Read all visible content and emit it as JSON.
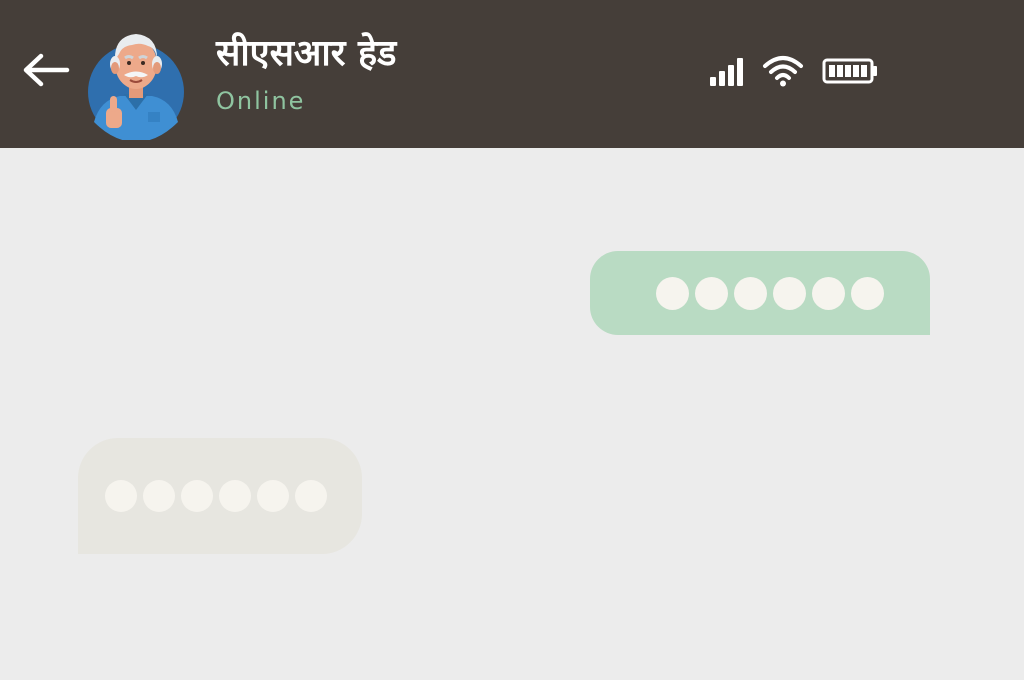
{
  "header": {
    "contact_name": "सीएसआर हेड",
    "contact_status": "Online",
    "background_color": "#453e39",
    "status_color": "#8fc4a0",
    "back_icon": "arrow-left-icon",
    "avatar_icon": "elderly-man-thumbs-up-avatar",
    "status_bar_icons": [
      "signal-icon",
      "wifi-icon",
      "battery-icon"
    ]
  },
  "chat": {
    "background_color": "#ececec",
    "messages": [
      {
        "direction": "outgoing",
        "content": "typing-dots",
        "dot_count": 6,
        "bubble_color": "#b9dbc3"
      },
      {
        "direction": "incoming",
        "content": "typing-dots",
        "dot_count": 6,
        "bubble_color": "#e7e6e0"
      }
    ]
  }
}
